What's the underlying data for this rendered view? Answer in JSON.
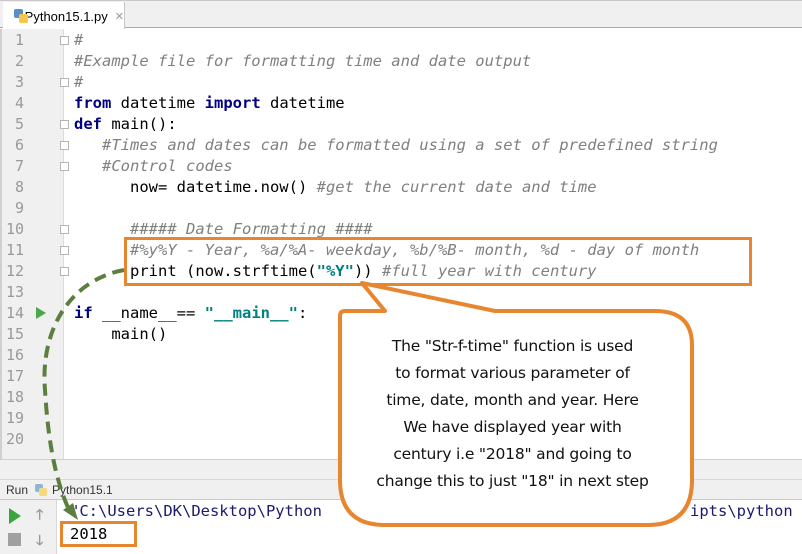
{
  "tab": {
    "filename": "Python15.1.py",
    "icon": "python-file-icon",
    "close_icon": "close-icon"
  },
  "editor": {
    "lines": [
      {
        "n": "1",
        "segments": [
          {
            "t": "#",
            "c": "cm"
          }
        ],
        "fold": "start"
      },
      {
        "n": "2",
        "segments": [
          {
            "t": "#Example file for formatting time and date output",
            "c": "cm"
          }
        ]
      },
      {
        "n": "3",
        "segments": [
          {
            "t": "#",
            "c": "cm"
          }
        ],
        "fold": "end"
      },
      {
        "n": "4",
        "segments": [
          {
            "t": "from",
            "c": "kw"
          },
          {
            "t": " datetime ",
            "c": ""
          },
          {
            "t": "import",
            "c": "kw"
          },
          {
            "t": " datetime",
            "c": ""
          }
        ]
      },
      {
        "n": "5",
        "segments": [
          {
            "t": "def",
            "c": "kw"
          },
          {
            "t": " main():",
            "c": ""
          }
        ],
        "fold": "start"
      },
      {
        "n": "6",
        "segments": [
          {
            "t": "   ",
            "c": ""
          },
          {
            "t": "#Times and dates can be formatted using a set of predefined string",
            "c": "cm"
          }
        ],
        "fold": "start"
      },
      {
        "n": "7",
        "segments": [
          {
            "t": "   ",
            "c": ""
          },
          {
            "t": "#Control codes",
            "c": "cm"
          }
        ],
        "fold": "end"
      },
      {
        "n": "8",
        "segments": [
          {
            "t": "      now= datetime.now() ",
            "c": ""
          },
          {
            "t": "#get the current date and time",
            "c": "cm"
          }
        ]
      },
      {
        "n": "9",
        "segments": []
      },
      {
        "n": "10",
        "segments": [
          {
            "t": "      ",
            "c": ""
          },
          {
            "t": "##### Date Formatting ####",
            "c": "cm"
          }
        ],
        "fold": "start"
      },
      {
        "n": "11",
        "segments": [
          {
            "t": "      ",
            "c": ""
          },
          {
            "t": "#%y%Y - Year, %a/%A- weekday, %b/%B- month, %d - day of month",
            "c": "cm"
          }
        ],
        "fold": "end"
      },
      {
        "n": "12",
        "segments": [
          {
            "t": "      print (now.strftime(",
            "c": ""
          },
          {
            "t": "\"%Y\"",
            "c": "str"
          },
          {
            "t": ")) ",
            "c": ""
          },
          {
            "t": "#full year with century",
            "c": "cm"
          }
        ],
        "fold": "end"
      },
      {
        "n": "13",
        "segments": []
      },
      {
        "n": "14",
        "segments": [
          {
            "t": "if",
            "c": "kw"
          },
          {
            "t": " __name__== ",
            "c": ""
          },
          {
            "t": "\"__main__\"",
            "c": "str"
          },
          {
            "t": ":",
            "c": ""
          }
        ],
        "run_marker": true
      },
      {
        "n": "15",
        "segments": [
          {
            "t": "    main()",
            "c": ""
          }
        ]
      },
      {
        "n": "16",
        "segments": []
      },
      {
        "n": "17",
        "segments": []
      },
      {
        "n": "18",
        "segments": []
      },
      {
        "n": "19",
        "segments": []
      },
      {
        "n": "20",
        "segments": []
      }
    ]
  },
  "run_panel": {
    "label": "Run",
    "config_name": "Python15.1",
    "command_line_start": "\"C:\\Users\\DK\\Desktop\\Python",
    "command_line_end": "ipts\\python",
    "output": "2018",
    "buttons": {
      "run": "play-icon",
      "stop": "stop-icon",
      "up": "arrow-up-icon",
      "down": "arrow-down-icon"
    }
  },
  "annotation": {
    "lines": [
      "The \"Str-f-time\" function is used",
      "to format various parameter of",
      "time, date, month and year. Here",
      "We have displayed year with",
      "century i.e \"2018\" and going to",
      "change this to just \"18\" in next step"
    ],
    "border_color": "#e8862f",
    "arrow_color": "#5a7f3e"
  }
}
